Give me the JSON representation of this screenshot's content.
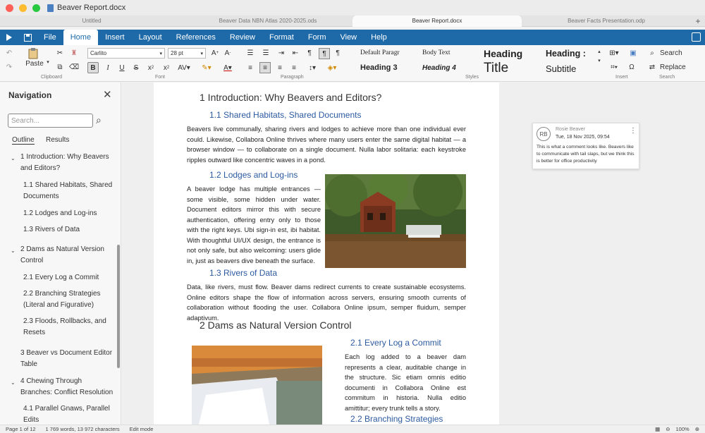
{
  "window": {
    "title": "Beaver Report.docx"
  },
  "tabs": [
    {
      "label": "Untitled"
    },
    {
      "label": "Beaver Data NBN Atlas 2020-2025.ods"
    },
    {
      "label": "Beaver Report.docx"
    },
    {
      "label": "Beaver Facts Presentation.odp"
    }
  ],
  "menu": [
    "File",
    "Home",
    "Insert",
    "Layout",
    "References",
    "Review",
    "Format",
    "Form",
    "View",
    "Help"
  ],
  "ribbon": {
    "paste": "Paste",
    "clipboard": "Clipboard",
    "font_name": "Carlito",
    "font_size": "28 pt",
    "font": "Font",
    "paragraph": "Paragraph",
    "styles_label": "Styles",
    "insert": "Insert",
    "search_group": "Search",
    "search": "Search",
    "replace": "Replace",
    "styles": [
      "Default Paragr",
      "Body Text",
      "Heading",
      "Heading :",
      "Heading 3",
      "Heading 4",
      "Title",
      "Subtitle"
    ]
  },
  "nav": {
    "title": "Navigation",
    "search_placeholder": "Search...",
    "tab_outline": "Outline",
    "tab_results": "Results",
    "items": [
      {
        "line1": "1  Introduction: Why Beavers",
        "line2": "and Editors?"
      },
      {
        "line1": "1.1  Shared Habitats, Shared",
        "line2": "Documents"
      },
      {
        "line1": "1.2  Lodges and Log-ins",
        "line2": ""
      },
      {
        "line1": "1.3  Rivers of Data",
        "line2": ""
      },
      {
        "line1": "2  Dams as Natural Version",
        "line2": "Control"
      },
      {
        "line1": "2.1  Every Log a Commit",
        "line2": ""
      },
      {
        "line1": "2.2  Branching Strategies",
        "line2": "(Literal and Figurative)"
      },
      {
        "line1": "2.3  Floods, Rollbacks, and",
        "line2": "Resets"
      },
      {
        "line1": "3  Beaver vs Document Editor",
        "line2": "Table"
      },
      {
        "line1": "4  Chewing Through",
        "line2": "Branches: Conflict Resolution"
      },
      {
        "line1": "4.1  Parallel Gnaws, Parallel",
        "line2": "Edits"
      }
    ]
  },
  "doc": {
    "h1_1": "1 Introduction: Why Beavers and Editors?",
    "h2_11": "1.1   Shared Habitats, Shared Documents",
    "p1": "Beavers live communally, sharing rivers and lodges to achieve more than one individual ever could. Likewise, Collabora Online thrives where many users enter the same digital habitat — a browser window — to collaborate on a single document. Nulla labor solitaria: each keystroke ripples outward like concentric waves in a pond.",
    "h2_12": "1.2   Lodges and Log-ins",
    "p2": "A beaver lodge has multiple entrances — some visible, some hidden under water. Document editors mirror this with secure authentication, offering entry only to those with the right keys. Ubi sign-in est, ibi habitat. With thoughtful UI/UX design, the entrance is not only safe, but also welcoming: users glide in, just as beavers dive beneath the surface.",
    "h2_13": "1.3   Rivers of Data",
    "p3": "Data, like rivers, must flow. Beaver dams redirect currents to create sustainable ecosystems. Online editors shape the flow of information across servers, ensuring smooth currents of collaboration without flooding the user. Collabora Online ipsum, semper fluidum, semper adaptivum.",
    "h1_2": "2 Dams as Natural Version Control",
    "h2_21": "2.1   Every Log a Commit",
    "p4": "Each log added to a beaver dam represents a clear, auditable change in the structure. Sic etiam omnis editio documenti in Collabora Online est commitum in historia. Nulla editio amittitur; every trunk tells a story.",
    "h2_22": "2.2   Branching   Strategies"
  },
  "comment": {
    "initials": "RB",
    "author": "Rosie Beaver",
    "date": "Tue, 18 Nov 2025, 09:54",
    "text": "This is what a comment looks like. Beavers like to communicate with tail slaps, but we think this is better for office productivity"
  },
  "status": {
    "page": "Page 1 of 12",
    "words": "1 769 words, 13 972 characters",
    "mode": "Edit mode",
    "zoom": "100%"
  },
  "colors": {
    "accent": "#1e6aa9",
    "heading": "#2c5aa0"
  }
}
